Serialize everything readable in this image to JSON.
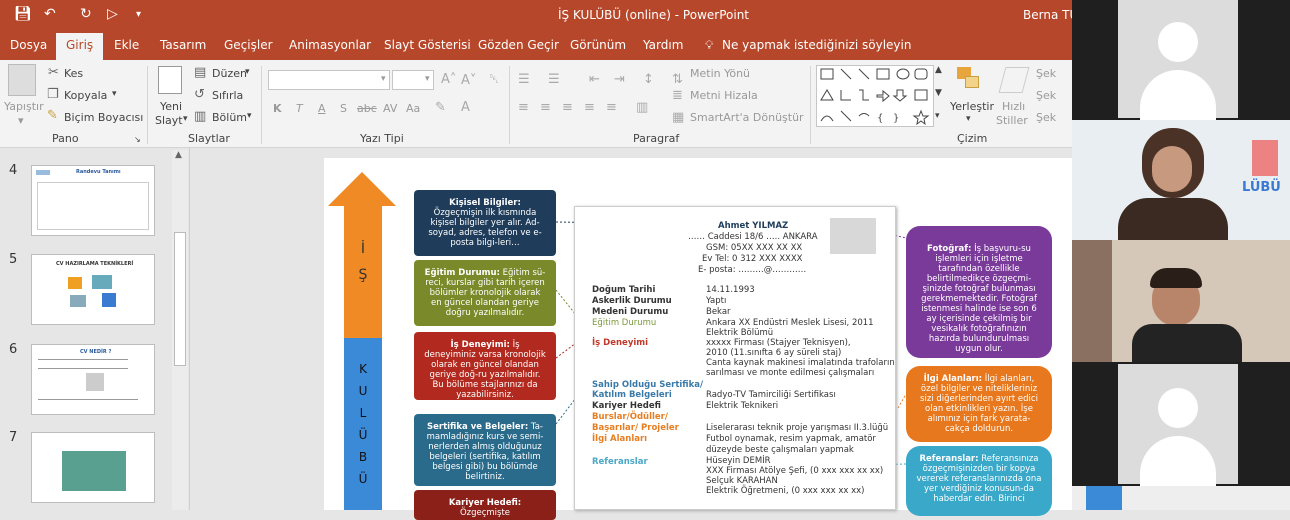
{
  "window": {
    "title": "İŞ KULÜBÜ (online)  -  PowerPoint",
    "user": "Berna TÜT"
  },
  "tabs": [
    "Dosya",
    "Giriş",
    "Ekle",
    "Tasarım",
    "Geçişler",
    "Animasyonlar",
    "Slayt Gösterisi",
    "Gözden Geçir",
    "Görünüm",
    "Yardım"
  ],
  "tell_me": "Ne yapmak istediğinizi söyleyin",
  "ribbon": {
    "pano": {
      "paste": "Yapıştır",
      "cut": "Kes",
      "copy": "Kopyala",
      "format": "Biçim Boyacısı",
      "label": "Pano"
    },
    "slaytlar": {
      "new": "Yeni",
      "new2": "Slayt",
      "layout": "Düzen",
      "reset": "Sıfırla",
      "section": "Bölüm",
      "label": "Slaytlar"
    },
    "yazi": {
      "label": "Yazı Tipi",
      "k": "K",
      "t": "T",
      "a": "A",
      "s": "S",
      "ab": "abc",
      "av": "AV",
      "aa": "Aa"
    },
    "paragraf": {
      "dir": "Metin Yönü",
      "align": "Metni Hizala",
      "smart": "SmartArt'a Dönüştür",
      "label": "Paragraf"
    },
    "cizim": {
      "arrange": "Yerleştir",
      "quick": "Hızlı",
      "quick2": "Stiller",
      "shape1": "Şek",
      "shape2": "Şek",
      "shape3": "Şek",
      "label": "Çizim"
    }
  },
  "thumbs": [
    {
      "num": "4",
      "title": "Randevu Tanımı"
    },
    {
      "num": "5",
      "title": "CV HAZIRLAMA TEKNİKLERİ"
    },
    {
      "num": "6",
      "title": "CV NEDİR ?"
    },
    {
      "num": "7",
      "title": ""
    }
  ],
  "slide": {
    "arrow_top": "İ\nŞ",
    "arrow_bottom": "K\nU\nL\nÜ\nB\nÜ",
    "left_pills": [
      {
        "bold": "Kişisel Bilgiler:",
        "text": " Özgeçmişin ilk kısmında kişisel bilgiler yer alır. Ad-soyad, adres, telefon ve e-posta bilgi-leri…",
        "color": "#1f3d5a"
      },
      {
        "bold": "Eğitim Durumu:",
        "text": " Eğitim sü-reci, kurslar gibi tarih içeren bölümler kronolojik olarak en güncel olandan geriye doğru yazılmalıdır.",
        "color": "#7a8a2a"
      },
      {
        "bold": "İş Deneyimi:",
        "text": " İş deneyiminiz varsa kronolojik olarak en güncel olandan geriye doğ-ru yazılmalıdır. Bu bölüme stajlarınızı da yazabilirsiniz.",
        "color": "#b22a1f"
      },
      {
        "bold": "Sertifika ve Belgeler:",
        "text": " Ta-mamladığınız kurs ve semi-nerlerden almış olduğunuz belgeleri (sertifika, katılım belgesi gibi) bu bölümde belirtiniz.",
        "color": "#2a6a8a"
      },
      {
        "bold": "Kariyer Hedefi:",
        "text": " Özgeçmişte",
        "color": "#8a2018"
      }
    ],
    "right_pills": [
      {
        "bold": "Fotoğraf:",
        "text": " İş başvuru-su işlemleri için işletme tarafından özellikle belirtilmedikçe özgeçmi-şinizde fotoğraf bulunması gerekmemektedir. Fotoğraf istenmesi halinde ise son 6 ay içerisinde çekilmiş bir vesikalık fotoğrafınızın hazırda bulundurulması uygun olur.",
        "color": "#7a3a9a"
      },
      {
        "bold": "İlgi Alanları:",
        "text": " İlgi alanları, özel bilgiler ve nitelikleriniz sizi diğerlerinden ayırt edici olan etkinlikleri yazın. İşe alımınız için fark yarata-cakça doldurun.",
        "color": "#e8781e"
      },
      {
        "bold": "Referanslar:",
        "text": " Referansınıza özgeçmişinizden bir kopya vererek referanslarınızda ona yer verdiğiniz konusun-da haberdar edin. Birinci",
        "color": "#3aa8c8"
      }
    ],
    "cv": {
      "name": "Ahmet YILMAZ",
      "addr": "…… Caddesi 18/6 ….. ANKARA",
      "gsm": "GSM: 05XX XXX XX XX",
      "tel": "Ev Tel: 0 312  XXX XXXX",
      "mail": "E- posta: ………@…………",
      "dob_l": "Doğum Tarihi",
      "dob_v": "14.11.1993",
      "mil_l": "Askerlik Durumu",
      "mil_v": "Yaptı",
      "med_l": "Medeni Durumu",
      "med_v": "Bekar",
      "edu_l": "Eğitim Durumu",
      "edu_v1": "Ankara XX Endüstri Meslek Lisesi, 2011",
      "edu_v2": "Elektrik Bölümü",
      "exp_l": "İş Deneyimi",
      "exp_v1": "xxxxx Firması  (Stajyer Teknisyen),",
      "exp_v2": "2010 (11.sınıfta 6 ay süreli staj)",
      "exp_v3": "Canta kaynak makinesi imalatında trafoların",
      "exp_v4": "sarılması ve monte edilmesi çalışmaları",
      "cert_l1": "Sahip Olduğu Sertifika/",
      "cert_l2": "Katılım Belgeleri",
      "cert_v": "Radyo-TV Tamirciliği Sertifikası",
      "goal_l": "Kariyer Hedefi",
      "goal_v": "Elektrik Teknikeri",
      "awd_l1": "Burslar/Ödüller/",
      "awd_l2": "Başarılar/ Projeler",
      "int_l": "İlgi Alanları",
      "awd_v1": "Liselerarası teknik proje yarışması II.3.lüğü",
      "awd_v2": "Futbol oynamak, resim yapmak, amatör",
      "awd_v3": "düzeyde beste çalışmaları yapmak",
      "ref_l": "Referanslar",
      "ref_v1": "Hüseyin DEMİR",
      "ref_v2": "XXX Firması Atölye Şefi, (0 xxx  xxx xx xx)",
      "ref_v3": "Selçuk KARAHAN",
      "ref_v4": "Elektrik Öğretmeni, (0 xxx  xxx xx xx)"
    },
    "logo_text": "LÜBÜ"
  },
  "colors": {
    "accent": "#b7472a"
  }
}
